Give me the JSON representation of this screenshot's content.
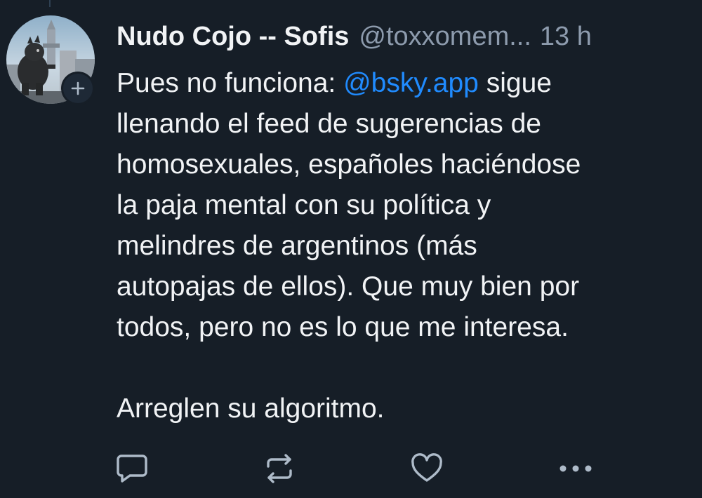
{
  "post": {
    "author": {
      "display_name": "Nudo Cojo -- Sofis",
      "handle": "@toxxomem...",
      "avatar_icon": "avatar-image",
      "follow_icon": "plus-icon"
    },
    "timestamp": "13 h",
    "text": {
      "line1_before": "Pues  no funciona: ",
      "mention": "@bsky.app",
      "line1_after": " sigue",
      "line2": "llenando el feed de sugerencias de",
      "line3": "homosexuales, españoles haciéndose",
      "line4": "la paja mental con su política y",
      "line5": "melindres de argentinos (más",
      "line6": "autopajas de ellos). Que muy bien por",
      "line7": "todos, pero no es lo que me interesa.",
      "line8": "Arreglen su algoritmo."
    },
    "actions": [
      {
        "name": "reply",
        "icon": "reply-icon"
      },
      {
        "name": "repost",
        "icon": "repost-icon"
      },
      {
        "name": "like",
        "icon": "heart-icon"
      },
      {
        "name": "more",
        "icon": "more-icon"
      }
    ]
  },
  "colors": {
    "background": "#161e27",
    "text": "#f1f3f5",
    "muted": "#8d9bad",
    "link": "#208bfe",
    "icon": "#aebbc9"
  }
}
